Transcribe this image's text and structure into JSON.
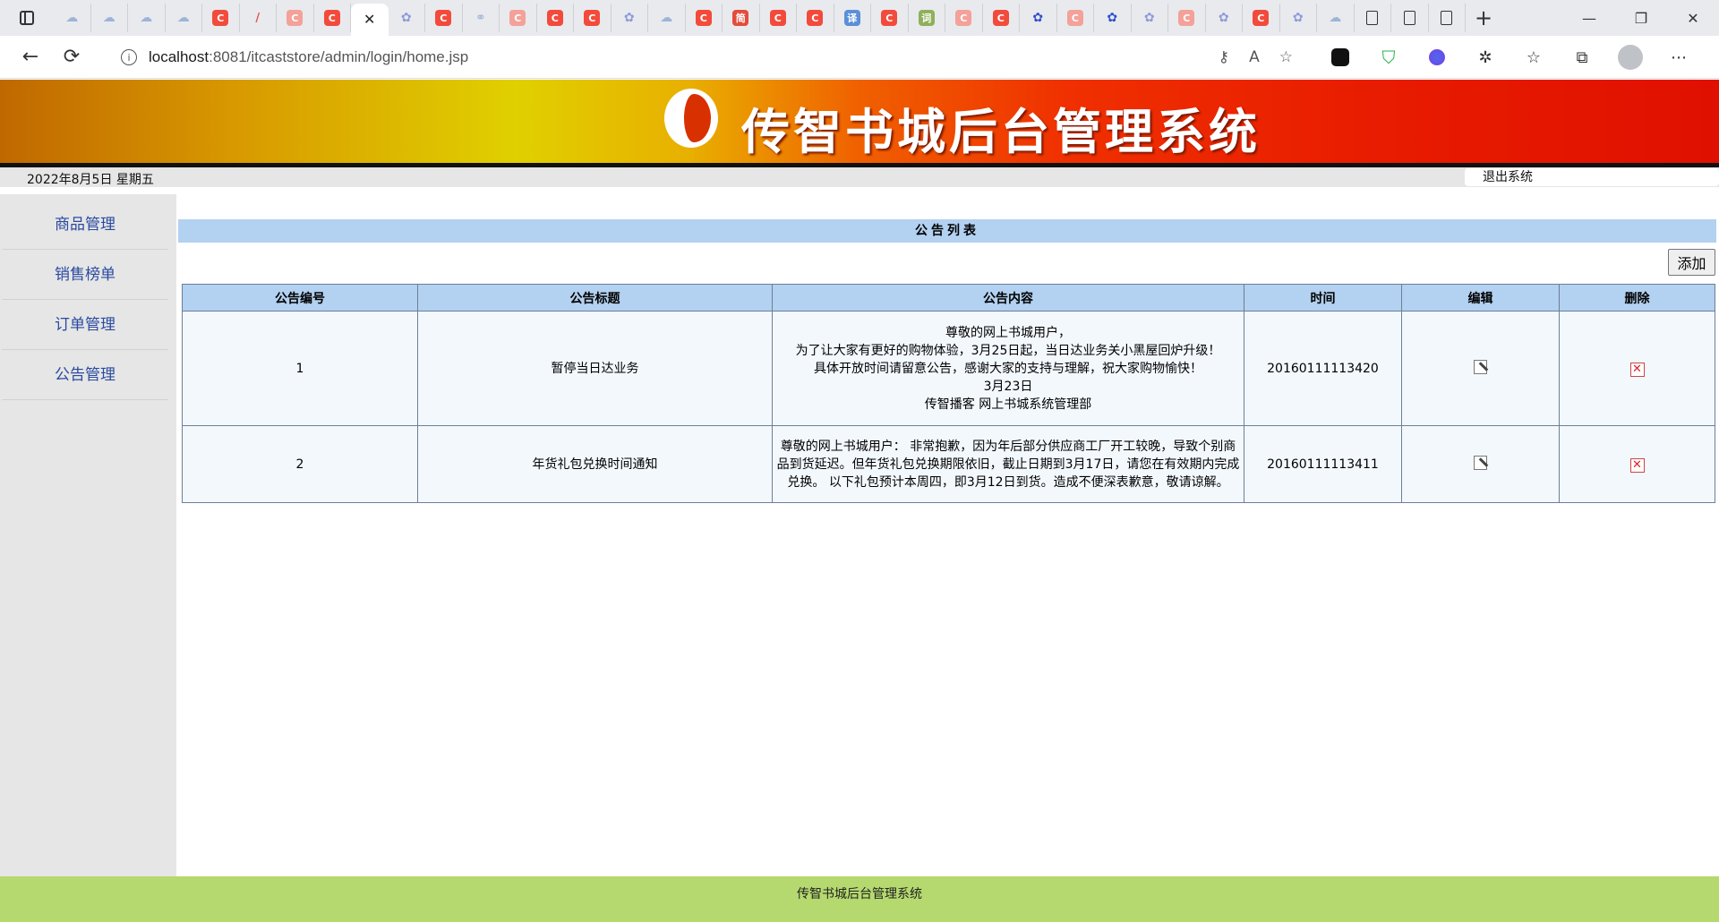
{
  "browser": {
    "tab_icons": [
      "cloud-icon",
      "cloud-icon",
      "cloud-icon",
      "cloud-icon",
      "c-icon",
      "pen-icon",
      "c-icon",
      "c-icon",
      "close-icon",
      "paw-icon",
      "c-icon",
      "link-icon",
      "c-icon",
      "c-icon",
      "c-icon",
      "paw-icon",
      "cloud-icon",
      "c-icon",
      "jian-icon",
      "c-icon",
      "c-icon",
      "translate-icon",
      "c-icon",
      "dict-icon",
      "c-icon",
      "c-icon",
      "paw-icon",
      "c-icon",
      "paw-icon",
      "paw-icon",
      "c-icon",
      "paw-icon",
      "c-icon",
      "paw-icon",
      "cloud-icon",
      "doc-icon",
      "doc-icon",
      "doc-icon"
    ],
    "tab_jian_label": "简",
    "tab_translate_label": "译",
    "tab_dict_label": "词",
    "new_tab_label": "+",
    "window_controls": {
      "minimize": "—",
      "restore": "❐",
      "close": "✕"
    },
    "url_host": "localhost",
    "url_path": ":8081/itcaststore/admin/login/home.jsp"
  },
  "header": {
    "title": "传智书城后台管理系统",
    "date": "2022年8月5日 星期五",
    "logout_label": "退出系统"
  },
  "sidebar": {
    "items": [
      {
        "label": "商品管理"
      },
      {
        "label": "销售榜单"
      },
      {
        "label": "订单管理"
      },
      {
        "label": "公告管理"
      }
    ]
  },
  "notice_list": {
    "heading": "公告列表",
    "add_label": "添加",
    "columns": [
      "公告编号",
      "公告标题",
      "公告内容",
      "时间",
      "编辑",
      "删除"
    ],
    "rows": [
      {
        "id": "1",
        "title": "暂停当日达业务",
        "content": "尊敬的网上书城用户，\n为了让大家有更好的购物体验，3月25日起，当日达业务关小黑屋回炉升级！\n具体开放时间请留意公告，感谢大家的支持与理解，祝大家购物愉快！\n3月23日\n传智播客 网上书城系统管理部",
        "time": "20160111113420"
      },
      {
        "id": "2",
        "title": "年货礼包兑换时间通知",
        "content": "尊敬的网上书城用户： 非常抱歉，因为年后部分供应商工厂开工较晚，导致个别商品到货延迟。但年货礼包兑换期限依旧，截止日期到3月17日，请您在有效期内完成兑换。 以下礼包预计本周四，即3月12日到货。造成不便深表歉意，敬请谅解。",
        "time": "20160111113411"
      }
    ]
  },
  "footer": {
    "text": "传智书城后台管理系统"
  }
}
